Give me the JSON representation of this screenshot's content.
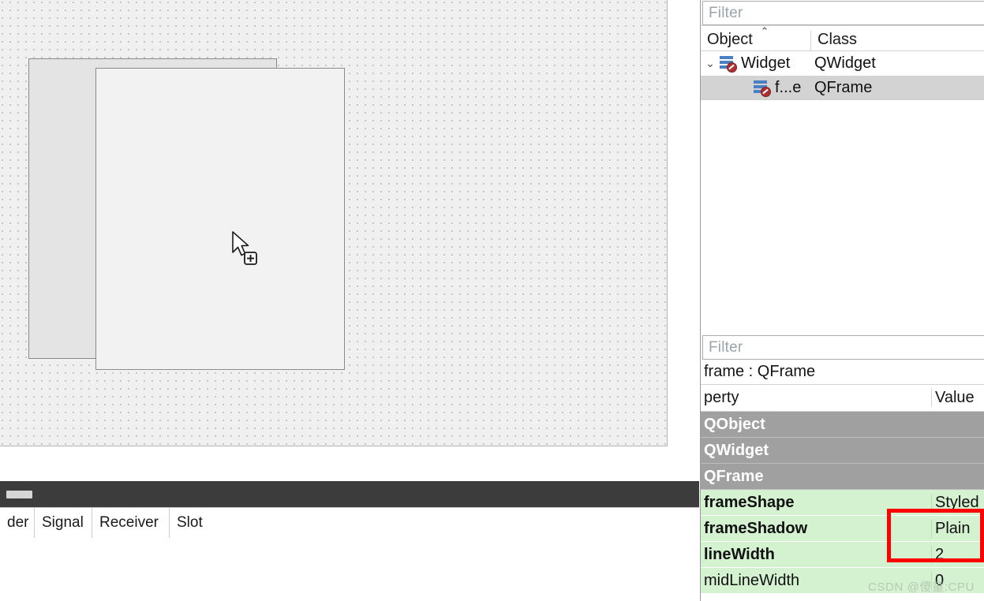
{
  "canvas": {
    "name": "form-design-canvas",
    "back_frame_label": "frame-back",
    "front_frame_label": "frame-front",
    "cursor_icon": "arrow-with-plus-badge-cursor"
  },
  "signal_slot_editor": {
    "columns": [
      "der",
      "Signal",
      "Receiver",
      "Slot"
    ],
    "rows": []
  },
  "object_inspector": {
    "filter_placeholder": "Filter",
    "sort_caret": "⌃",
    "columns": {
      "object": "Object",
      "class": "Class"
    },
    "rows": [
      {
        "twisty": "⌄",
        "icon": "qt-widget-icon",
        "object": "Widget",
        "class": "QWidget",
        "selected": false,
        "depth": 0
      },
      {
        "twisty": "",
        "icon": "qt-widget-icon",
        "object": "f...e",
        "class": "QFrame",
        "selected": true,
        "depth": 1
      }
    ]
  },
  "property_editor": {
    "filter_placeholder": "Filter",
    "subject": "frame : QFrame",
    "columns": {
      "property": "perty",
      "value": "Value"
    },
    "rows": [
      {
        "type": "group",
        "name": "QObject",
        "value": ""
      },
      {
        "type": "group",
        "name": "QWidget",
        "value": ""
      },
      {
        "type": "group",
        "name": "QFrame",
        "value": ""
      },
      {
        "type": "prop",
        "name": "frameShape",
        "value": "Styled",
        "bold": true
      },
      {
        "type": "prop",
        "name": "frameShadow",
        "value": "Plain",
        "bold": true
      },
      {
        "type": "prop",
        "name": "lineWidth",
        "value": "2",
        "bold": true
      },
      {
        "type": "prop",
        "name": "midLineWidth",
        "value": "0",
        "bold": false
      }
    ]
  },
  "annotation": {
    "color": "#ff0000",
    "label": "highlight-frameShadow-lineWidth"
  },
  "watermark": {
    "text": "CSDN @傻童:CPU"
  },
  "colors": {
    "group_row_bg": "#a0a0a0",
    "property_row_bg": "#d4f1d0",
    "selected_row_bg": "#d3d3d3",
    "canvas_bg": "#f0f0f0",
    "dock_bar_bg": "#3c3c3c",
    "annotation_red": "#ff0000"
  }
}
